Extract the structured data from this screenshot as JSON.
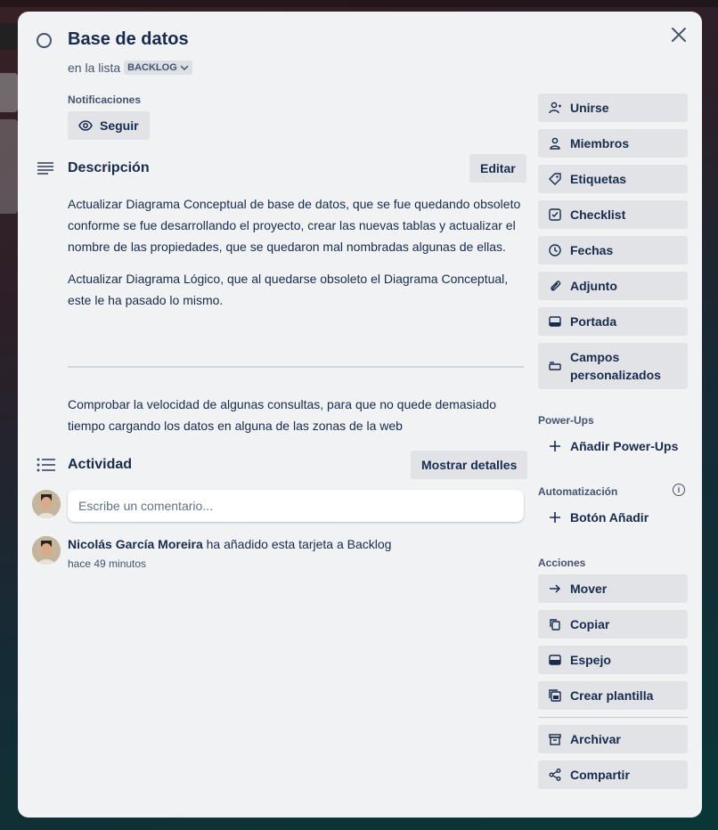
{
  "card": {
    "title": "Base de datos",
    "list_prefix": "en la lista",
    "list_name": "BACKLOG"
  },
  "notifications": {
    "label": "Notificaciones",
    "follow_label": "Seguir"
  },
  "description": {
    "title": "Descripción",
    "edit_label": "Editar",
    "paragraphs": [
      "Actualizar Diagrama Conceptual de base de datos, que se fue quedando obsoleto conforme se fue desarrollando el proyecto, crear las nuevas tablas y actualizar el nombre de las propiedades, que se quedaron mal nombradas algunas de ellas.",
      "Actualizar Diagrama Lógico, que al quedarse obsoleto el Diagrama Conceptual, este le ha pasado lo mismo."
    ],
    "after_rule": "Comprobar la velocidad de algunas consultas, para que no quede demasiado tiempo cargando los datos en alguna de las zonas de la web"
  },
  "activity": {
    "title": "Actividad",
    "details_label": "Mostrar detalles",
    "comment_placeholder": "Escribe un comentario...",
    "entries": [
      {
        "user": "Nicolás García Moreira",
        "action": " ha añadido esta tarjeta a Backlog",
        "time": "hace 49 minutos"
      }
    ]
  },
  "sidebar": {
    "add_to_card": [
      {
        "label": "Unirse",
        "icon": "user-plus-icon"
      },
      {
        "label": "Miembros",
        "icon": "user-icon"
      },
      {
        "label": "Etiquetas",
        "icon": "tag-icon"
      },
      {
        "label": "Checklist",
        "icon": "checkbox-icon"
      },
      {
        "label": "Fechas",
        "icon": "clock-icon"
      },
      {
        "label": "Adjunto",
        "icon": "paperclip-icon"
      },
      {
        "label": "Portada",
        "icon": "card-cover-icon"
      },
      {
        "label": "Campos personalizados",
        "icon": "custom-fields-icon"
      }
    ],
    "powerups_label": "Power-Ups",
    "powerups_add": "Añadir Power-Ups",
    "automation_label": "Automatización",
    "automation_add": "Botón Añadir",
    "actions_label": "Acciones",
    "actions": [
      {
        "label": "Mover",
        "icon": "arrow-right-icon"
      },
      {
        "label": "Copiar",
        "icon": "copy-icon"
      },
      {
        "label": "Espejo",
        "icon": "mirror-icon"
      },
      {
        "label": "Crear plantilla",
        "icon": "template-icon"
      },
      {
        "label": "Archivar",
        "icon": "archive-icon"
      },
      {
        "label": "Compartir",
        "icon": "share-icon"
      }
    ]
  },
  "colors": {
    "modal_bg": "#f1f2f4",
    "button_bg": "#e1e3e7",
    "text": "#172b4d",
    "subtle_text": "#44546f"
  }
}
